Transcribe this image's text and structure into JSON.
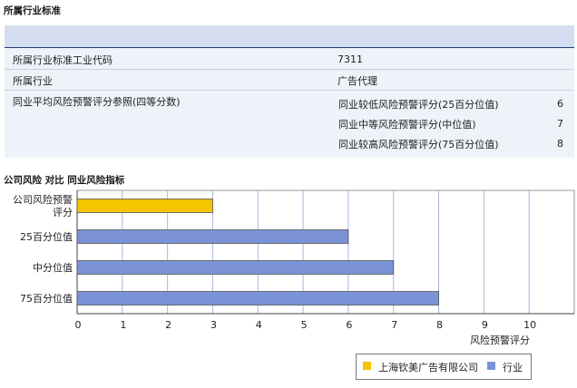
{
  "industry_section": {
    "title": "所属行业标准",
    "rows": [
      {
        "label": "所属行业标准工业代码",
        "value": "7311"
      },
      {
        "label": "所属行业",
        "value": "广告代理"
      },
      {
        "label": "同业平均风险预警评分参照(四等分数)",
        "sub": [
          {
            "label": "同业较低风险预警评分(25百分位值)",
            "value": "6"
          },
          {
            "label": "同业中等风险预警评分(中位值)",
            "value": "7"
          },
          {
            "label": "同业较高风险预警评分(75百分位值)",
            "value": "8"
          }
        ]
      }
    ]
  },
  "chart_section": {
    "title": "公司风险 对比 同业风险指标"
  },
  "chart_data": {
    "type": "bar",
    "orientation": "horizontal",
    "categories": [
      "公司风险预警评分",
      "25百分位值",
      "中分位值",
      "75百分位值"
    ],
    "category_labels": [
      [
        "公司风险预警",
        "评分"
      ],
      [
        "25百分位值"
      ],
      [
        "中分位值"
      ],
      [
        "75百分位值"
      ]
    ],
    "series": [
      {
        "name": "上海钦美广告有限公司",
        "color": "#f5c400",
        "values": [
          3,
          null,
          null,
          null
        ]
      },
      {
        "name": "行业",
        "color": "#7b93d6",
        "values": [
          null,
          6,
          7,
          8
        ]
      }
    ],
    "x_ticks": [
      "0",
      "1",
      "2",
      "3",
      "4",
      "5",
      "6",
      "7",
      "8",
      "9",
      "10"
    ],
    "xlim": [
      0,
      11
    ],
    "xlabel": "风险预警评分",
    "grid": true,
    "legend_position": "bottom-right"
  }
}
